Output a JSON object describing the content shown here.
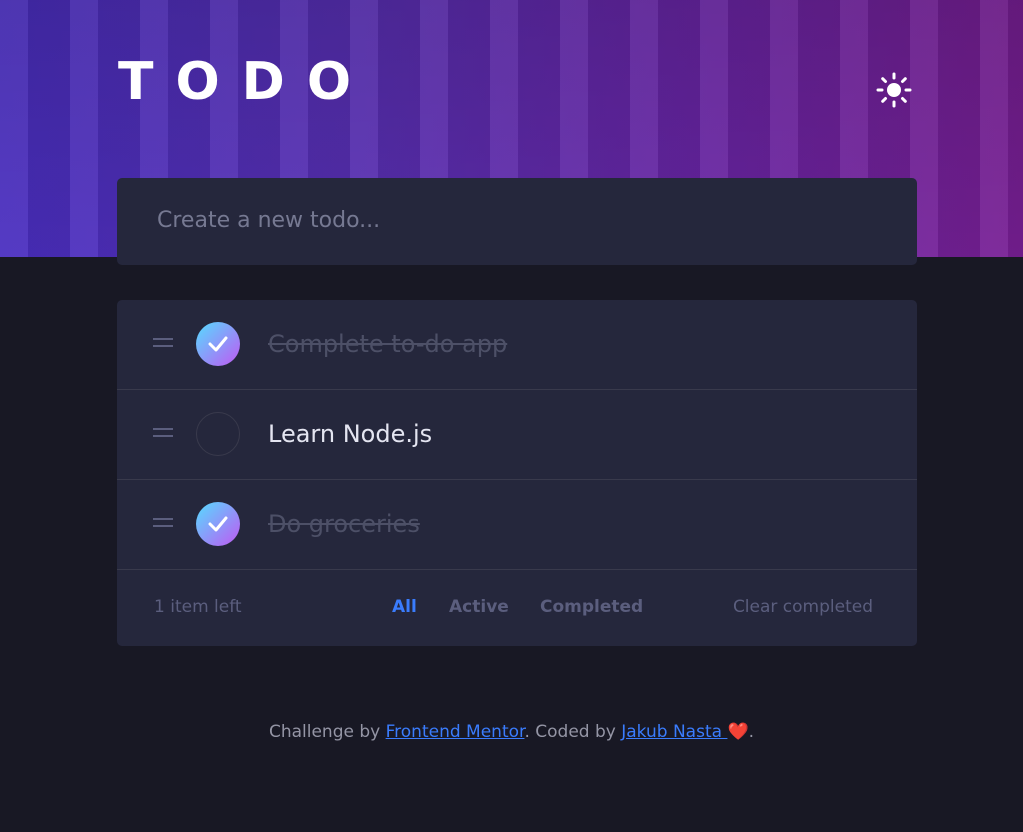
{
  "header": {
    "title": "TODO",
    "theme_icon": "sun-icon"
  },
  "new_todo": {
    "placeholder": "Create a new todo..."
  },
  "todos": [
    {
      "text": "Complete to-do app",
      "completed": true
    },
    {
      "text": "Learn Node.js",
      "completed": false
    },
    {
      "text": "Do groceries",
      "completed": true
    }
  ],
  "footer": {
    "items_left": "1 item left",
    "filters": [
      {
        "label": "All",
        "active": true
      },
      {
        "label": "Active",
        "active": false
      },
      {
        "label": "Completed",
        "active": false
      }
    ],
    "clear_label": "Clear completed"
  },
  "credit": {
    "prefix": "Challenge by ",
    "link1": "Frontend Mentor",
    "middle": ". Coded by ",
    "link2": "Jakub Nasta ",
    "heart": "❤️",
    "suffix": "."
  },
  "colors": {
    "accent": "#3a7cfd",
    "check_gradient_start": "#55ddff",
    "check_gradient_end": "#c058f3",
    "background": "#181824",
    "card": "#25273c"
  }
}
